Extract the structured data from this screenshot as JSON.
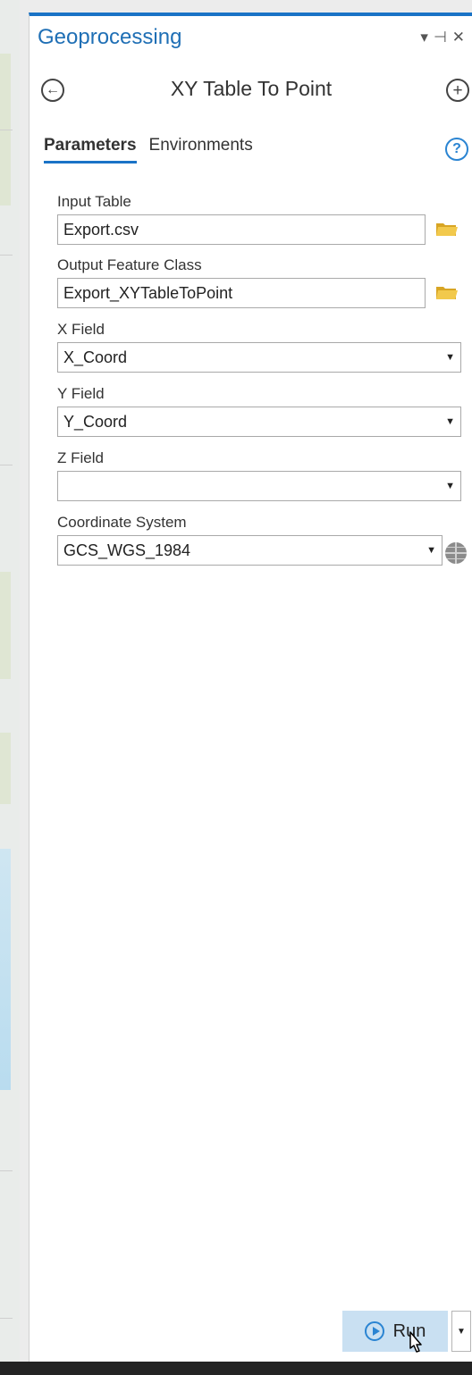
{
  "pane": {
    "title": "Geoprocessing",
    "controls": {
      "menu": "▾",
      "pin": "⊣",
      "close": "✕"
    }
  },
  "tool": {
    "title": "XY Table To Point"
  },
  "tabs": [
    {
      "label": "Parameters",
      "active": true
    },
    {
      "label": "Environments",
      "active": false
    }
  ],
  "help": "?",
  "params": {
    "input_table": {
      "label": "Input Table",
      "value": "Export.csv"
    },
    "output_feature_class": {
      "label": "Output Feature Class",
      "value": "Export_XYTableToPoint"
    },
    "x_field": {
      "label": "X Field",
      "value": "X_Coord"
    },
    "y_field": {
      "label": "Y Field",
      "value": "Y_Coord"
    },
    "z_field": {
      "label": "Z Field",
      "value": ""
    },
    "coordinate_system": {
      "label": "Coordinate System",
      "value": "GCS_WGS_1984"
    }
  },
  "run": {
    "label": "Run"
  },
  "colors": {
    "accent": "#1a73c6",
    "title": "#1f6fb5",
    "run_bg": "#c9e0f2",
    "folder": "#e8b830"
  },
  "icons": [
    "back-arrow-icon",
    "add-icon",
    "help-icon",
    "folder-icon",
    "globe-icon",
    "play-icon",
    "dropdown-arrow-icon",
    "pointer-cursor-icon"
  ]
}
